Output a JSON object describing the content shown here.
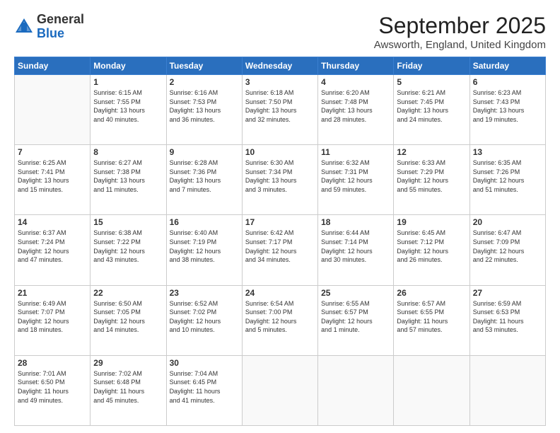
{
  "logo": {
    "general": "General",
    "blue": "Blue"
  },
  "header": {
    "month": "September 2025",
    "location": "Awsworth, England, United Kingdom"
  },
  "weekdays": [
    "Sunday",
    "Monday",
    "Tuesday",
    "Wednesday",
    "Thursday",
    "Friday",
    "Saturday"
  ],
  "weeks": [
    [
      {
        "day": "",
        "info": ""
      },
      {
        "day": "1",
        "info": "Sunrise: 6:15 AM\nSunset: 7:55 PM\nDaylight: 13 hours\nand 40 minutes."
      },
      {
        "day": "2",
        "info": "Sunrise: 6:16 AM\nSunset: 7:53 PM\nDaylight: 13 hours\nand 36 minutes."
      },
      {
        "day": "3",
        "info": "Sunrise: 6:18 AM\nSunset: 7:50 PM\nDaylight: 13 hours\nand 32 minutes."
      },
      {
        "day": "4",
        "info": "Sunrise: 6:20 AM\nSunset: 7:48 PM\nDaylight: 13 hours\nand 28 minutes."
      },
      {
        "day": "5",
        "info": "Sunrise: 6:21 AM\nSunset: 7:45 PM\nDaylight: 13 hours\nand 24 minutes."
      },
      {
        "day": "6",
        "info": "Sunrise: 6:23 AM\nSunset: 7:43 PM\nDaylight: 13 hours\nand 19 minutes."
      }
    ],
    [
      {
        "day": "7",
        "info": "Sunrise: 6:25 AM\nSunset: 7:41 PM\nDaylight: 13 hours\nand 15 minutes."
      },
      {
        "day": "8",
        "info": "Sunrise: 6:27 AM\nSunset: 7:38 PM\nDaylight: 13 hours\nand 11 minutes."
      },
      {
        "day": "9",
        "info": "Sunrise: 6:28 AM\nSunset: 7:36 PM\nDaylight: 13 hours\nand 7 minutes."
      },
      {
        "day": "10",
        "info": "Sunrise: 6:30 AM\nSunset: 7:34 PM\nDaylight: 13 hours\nand 3 minutes."
      },
      {
        "day": "11",
        "info": "Sunrise: 6:32 AM\nSunset: 7:31 PM\nDaylight: 12 hours\nand 59 minutes."
      },
      {
        "day": "12",
        "info": "Sunrise: 6:33 AM\nSunset: 7:29 PM\nDaylight: 12 hours\nand 55 minutes."
      },
      {
        "day": "13",
        "info": "Sunrise: 6:35 AM\nSunset: 7:26 PM\nDaylight: 12 hours\nand 51 minutes."
      }
    ],
    [
      {
        "day": "14",
        "info": "Sunrise: 6:37 AM\nSunset: 7:24 PM\nDaylight: 12 hours\nand 47 minutes."
      },
      {
        "day": "15",
        "info": "Sunrise: 6:38 AM\nSunset: 7:22 PM\nDaylight: 12 hours\nand 43 minutes."
      },
      {
        "day": "16",
        "info": "Sunrise: 6:40 AM\nSunset: 7:19 PM\nDaylight: 12 hours\nand 38 minutes."
      },
      {
        "day": "17",
        "info": "Sunrise: 6:42 AM\nSunset: 7:17 PM\nDaylight: 12 hours\nand 34 minutes."
      },
      {
        "day": "18",
        "info": "Sunrise: 6:44 AM\nSunset: 7:14 PM\nDaylight: 12 hours\nand 30 minutes."
      },
      {
        "day": "19",
        "info": "Sunrise: 6:45 AM\nSunset: 7:12 PM\nDaylight: 12 hours\nand 26 minutes."
      },
      {
        "day": "20",
        "info": "Sunrise: 6:47 AM\nSunset: 7:09 PM\nDaylight: 12 hours\nand 22 minutes."
      }
    ],
    [
      {
        "day": "21",
        "info": "Sunrise: 6:49 AM\nSunset: 7:07 PM\nDaylight: 12 hours\nand 18 minutes."
      },
      {
        "day": "22",
        "info": "Sunrise: 6:50 AM\nSunset: 7:05 PM\nDaylight: 12 hours\nand 14 minutes."
      },
      {
        "day": "23",
        "info": "Sunrise: 6:52 AM\nSunset: 7:02 PM\nDaylight: 12 hours\nand 10 minutes."
      },
      {
        "day": "24",
        "info": "Sunrise: 6:54 AM\nSunset: 7:00 PM\nDaylight: 12 hours\nand 5 minutes."
      },
      {
        "day": "25",
        "info": "Sunrise: 6:55 AM\nSunset: 6:57 PM\nDaylight: 12 hours\nand 1 minute."
      },
      {
        "day": "26",
        "info": "Sunrise: 6:57 AM\nSunset: 6:55 PM\nDaylight: 11 hours\nand 57 minutes."
      },
      {
        "day": "27",
        "info": "Sunrise: 6:59 AM\nSunset: 6:53 PM\nDaylight: 11 hours\nand 53 minutes."
      }
    ],
    [
      {
        "day": "28",
        "info": "Sunrise: 7:01 AM\nSunset: 6:50 PM\nDaylight: 11 hours\nand 49 minutes."
      },
      {
        "day": "29",
        "info": "Sunrise: 7:02 AM\nSunset: 6:48 PM\nDaylight: 11 hours\nand 45 minutes."
      },
      {
        "day": "30",
        "info": "Sunrise: 7:04 AM\nSunset: 6:45 PM\nDaylight: 11 hours\nand 41 minutes."
      },
      {
        "day": "",
        "info": ""
      },
      {
        "day": "",
        "info": ""
      },
      {
        "day": "",
        "info": ""
      },
      {
        "day": "",
        "info": ""
      }
    ]
  ]
}
